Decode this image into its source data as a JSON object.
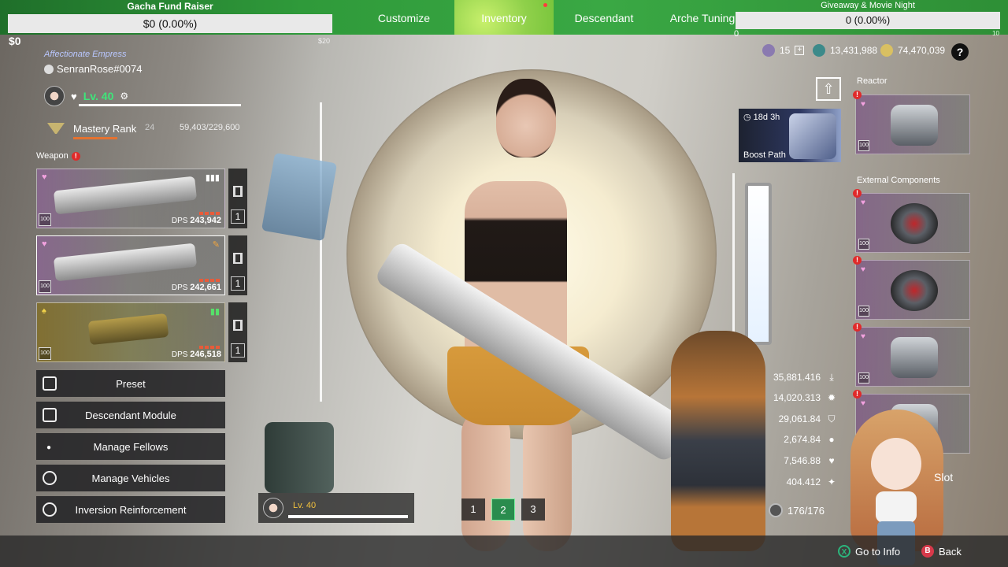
{
  "stream": {
    "fund_left": {
      "title": "Gacha Fund Raiser",
      "value": "$0 (0.00%)",
      "progress_percent": 0
    },
    "fund_right": {
      "title": "Giveaway & Movie Night",
      "value": "0 (0.00%)",
      "min_label": "0",
      "max_label": "10",
      "progress_percent": 0
    },
    "cash_left": "$0",
    "cash_small": "$20"
  },
  "nav": {
    "tabs": [
      {
        "label": "Customize",
        "active": false
      },
      {
        "label": "Inventory",
        "active": true
      },
      {
        "label": "Descendant",
        "active": false
      },
      {
        "label": "Arche Tuning",
        "active": false
      }
    ]
  },
  "profile": {
    "title": "Affectionate Empress",
    "name": "SenranRose#0074",
    "level": "Lv. 40",
    "mastery_label": "Mastery Rank",
    "mastery_rank": "24",
    "mastery_points": "59,403/229,600"
  },
  "weapon_section": {
    "label": "Weapon"
  },
  "weapons": [
    {
      "dps_label": "DPS",
      "dps": "243,942",
      "slot": "1",
      "level": "100"
    },
    {
      "dps_label": "DPS",
      "dps": "242,661",
      "slot": "1",
      "level": "100"
    },
    {
      "dps_label": "DPS",
      "dps": "246,518",
      "slot": "1",
      "level": "100"
    }
  ],
  "menu": [
    {
      "label": "Preset"
    },
    {
      "label": "Descendant Module"
    },
    {
      "label": "Manage Fellows"
    },
    {
      "label": "Manage Vehicles"
    },
    {
      "label": "Inversion Reinforcement"
    }
  ],
  "mini_level": "Lv. 40",
  "presets": {
    "items": [
      "1",
      "2",
      "3"
    ],
    "active": "2"
  },
  "currencies": {
    "first": "15",
    "second": "13,431,988",
    "third": "74,470,039",
    "help": "?"
  },
  "boost": {
    "timer": "18d 3h",
    "name": "Boost Path"
  },
  "reactor": {
    "label": "Reactor",
    "level": "100"
  },
  "external": {
    "label": "External Components",
    "levels": [
      "100",
      "100",
      "100",
      "100"
    ]
  },
  "stats": [
    {
      "value": "35,881.416",
      "icon": "download-icon"
    },
    {
      "value": "14,020.313",
      "icon": "gear-icon"
    },
    {
      "value": "29,061.84",
      "icon": "shield-icon"
    },
    {
      "value": "2,674.84",
      "icon": "circle-icon"
    },
    {
      "value": "7,546.88",
      "icon": "heart-icon"
    },
    {
      "value": "404.412",
      "icon": "sparkle-icon"
    }
  ],
  "inventory_count": "176/176",
  "slot_label": "Slot",
  "hints": [
    {
      "button": "X",
      "label": "Go to Info",
      "color": "#2bb57c"
    },
    {
      "button": "B",
      "label": "Back",
      "color": "#d8394a"
    }
  ]
}
